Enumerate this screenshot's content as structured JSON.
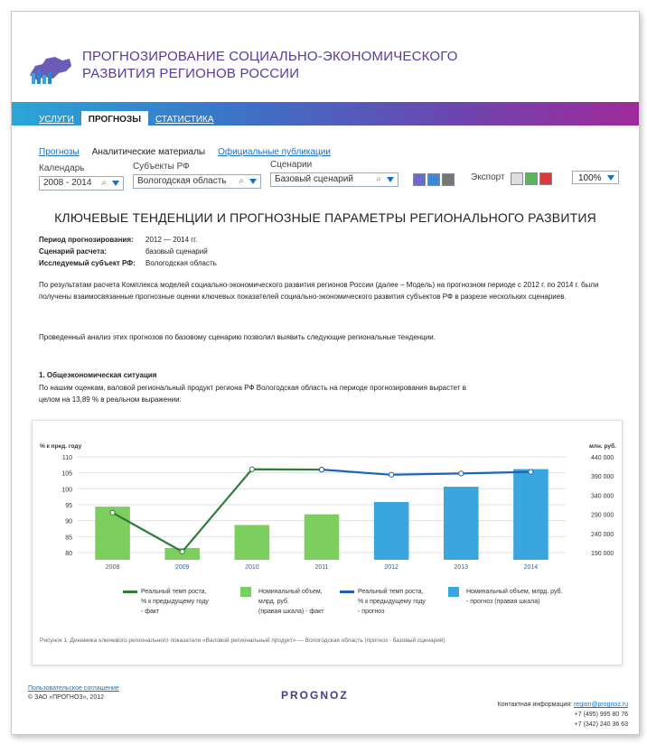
{
  "header": {
    "title_line1": "Прогнозирование социально-экономического",
    "title_line2": "развития регионов России"
  },
  "topnav": [
    "Услуги",
    "Прогнозы",
    "Статистика"
  ],
  "subnav": {
    "link1": "Прогнозы",
    "current": "Аналитические материалы",
    "link2": "Официальные публикации"
  },
  "filters": {
    "calendar_label": "Календарь",
    "calendar_value": "2008 - 2014",
    "subjects_label": "Субъекты РФ",
    "subjects_value": "Вологодская область",
    "scenarios_label": "Сценарии",
    "scenarios_value": "Базовый сценарий",
    "export_label": "Экспорт",
    "zoom_value": "100%"
  },
  "report": {
    "title": "Ключевые тенденции и прогнозные параметры регионального развития",
    "meta": [
      {
        "key": "Период прогнозирования:",
        "value": "2012 — 2014 гг."
      },
      {
        "key": "Сценарий расчета:",
        "value": "базовый сценарий"
      },
      {
        "key": "Исследуемый субъект РФ:",
        "value": "Вологодская область"
      }
    ],
    "para1": "По результатам расчета Комплекса моделей социально-экономического развития регионов России (далее – Модель) на прогнозном периоде с 2012 г. по 2014 г. были получены взаимосвязанные прогнозные оценки ключевых показателей социально-экономического развития субъектов РФ в разрезе нескольких сценариев.",
    "para2": "Проведенный анализ этих прогнозов по базовому сценарию позволил выявить следующие региональные тенденции.",
    "section1_title": "1. Общеэкономическая ситуация",
    "section1_text": "По нашим оценкам, валовой региональный продукт региона РФ Вологодская область на периоде прогнозирования вырастет в целом на 13,89 % в реальном выражении:"
  },
  "chart_data": {
    "type": "bar",
    "categories": [
      "2008",
      "2009",
      "2010",
      "2011",
      "2012",
      "2013",
      "2014"
    ],
    "left_axis": {
      "label": "% к пред. году",
      "ticks": [
        "110",
        "105",
        "100",
        "95",
        "90",
        "85",
        "80"
      ],
      "ylim": [
        80,
        110
      ]
    },
    "right_axis": {
      "label": "млн. руб.",
      "ticks": [
        "440 000",
        "390 000",
        "340 000",
        "290 000",
        "240 000",
        "190 000"
      ],
      "ylim": [
        190000,
        440000
      ]
    },
    "series": [
      {
        "name": "Номинальный объем, млрд. руб. (правая шкала) - факт",
        "kind": "bar",
        "axis": "right",
        "color": "#7ccf5e",
        "values": [
          310000,
          202000,
          262000,
          290000,
          null,
          null,
          null
        ]
      },
      {
        "name": "Номинальный объем, млрд. руб. - прогноз (правая шкала)",
        "kind": "bar",
        "axis": "right",
        "color": "#3aa6e0",
        "values": [
          null,
          null,
          null,
          null,
          322000,
          362000,
          408000
        ]
      },
      {
        "name": "Реальный темп роста, % к предыдущему году - факт",
        "kind": "line",
        "axis": "left",
        "color": "#2e7d3a",
        "values": [
          92.5,
          80.3,
          106.1,
          106.0,
          null,
          null,
          null
        ]
      },
      {
        "name": "Реальный темп роста, % к предыдущему году - прогноз",
        "kind": "line",
        "axis": "left",
        "color": "#1f63b8",
        "values": [
          null,
          null,
          null,
          106.0,
          104.4,
          104.8,
          105.3
        ]
      }
    ],
    "legend": [
      {
        "lines": [
          "Реальный темп роста,",
          "% к предыдущему году",
          "- факт"
        ],
        "color": "#2e7d3a",
        "kind": "line"
      },
      {
        "lines": [
          "Номинальный объем,",
          "млрд. руб.",
          "(правая шкала) - факт"
        ],
        "color": "#7ccf5e",
        "kind": "box"
      },
      {
        "lines": [
          "Реальный темп роста,",
          "% к предыдущему году",
          "- прогноз"
        ],
        "color": "#1f63b8",
        "kind": "line"
      },
      {
        "lines": [
          "Номинальный объем, млрд. руб.",
          "- прогноз (правая шкала)"
        ],
        "color": "#3aa6e0",
        "kind": "box"
      }
    ],
    "caption": "Рисунок 1. Динамика ключевого регионального показателя «Валовой региональный продукт» — Вологодская область (прогноз - базовый сценарий)"
  },
  "footer": {
    "agreement": "Пользовательское соглашение",
    "copyright": "© ЗАО «ПРОГНОЗ», 2012",
    "brand": "PROGNOZ",
    "contact_label": "Контактная информация:",
    "email": "region@prognoz.ru",
    "phone1": "+7 (495) 995 80 76",
    "phone2": "+7 (342) 240 36 63"
  }
}
